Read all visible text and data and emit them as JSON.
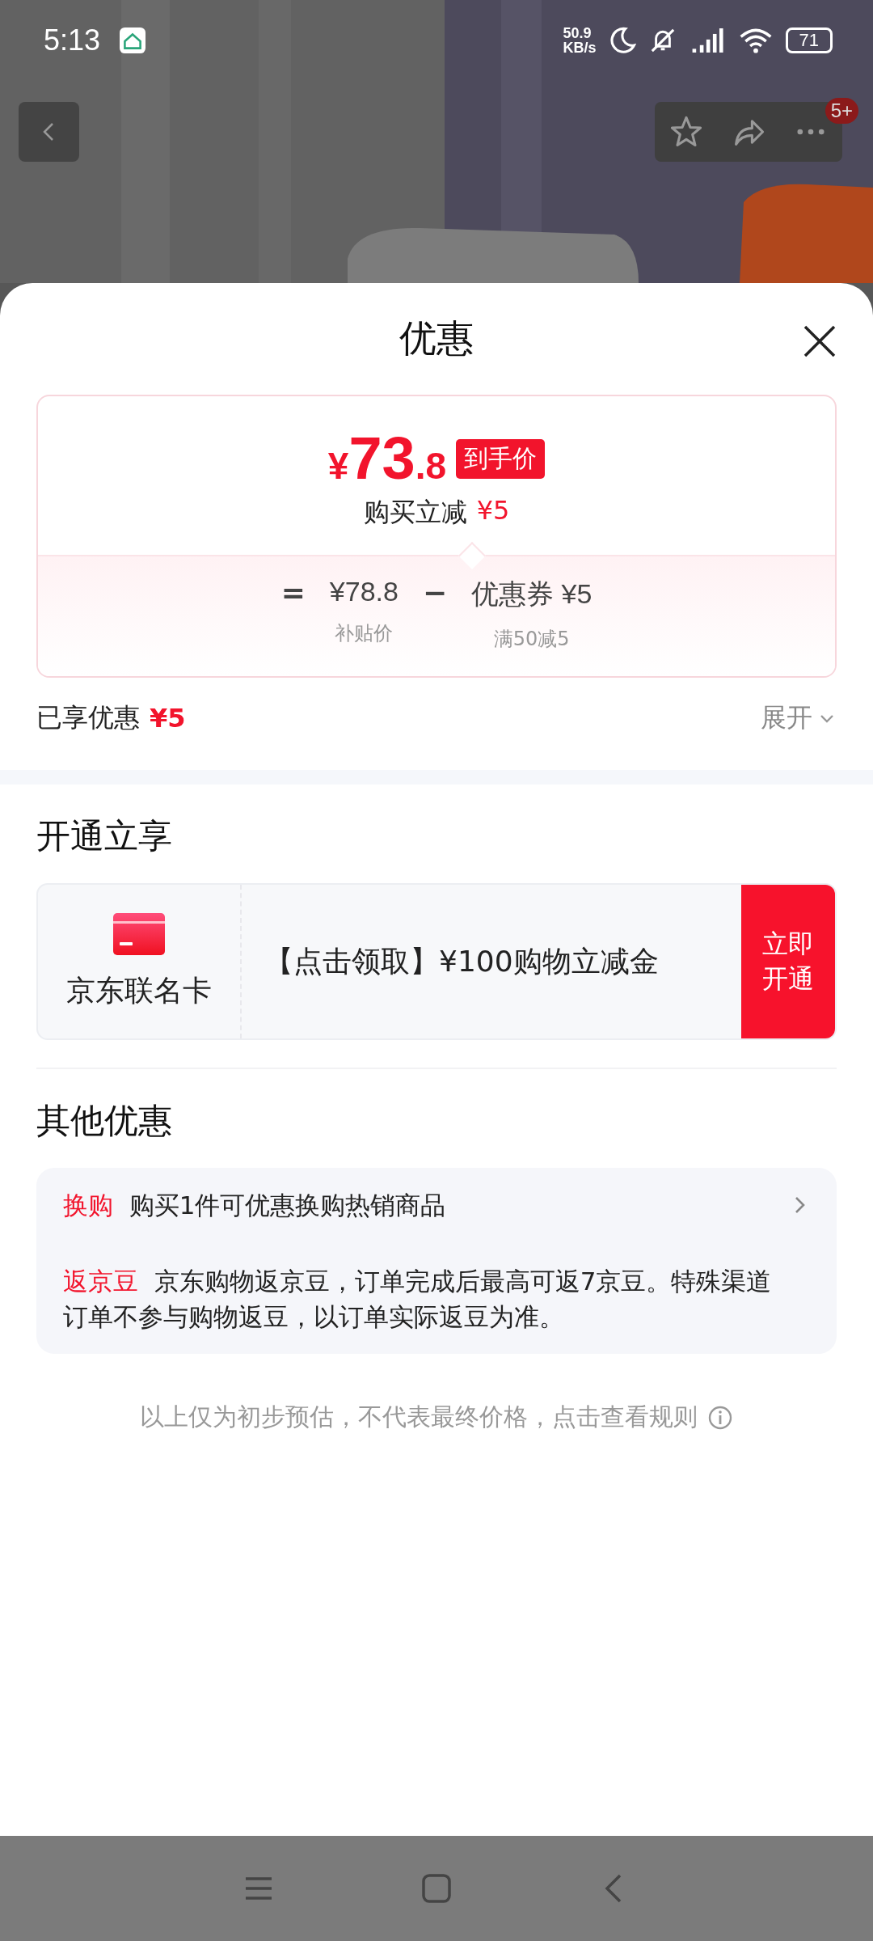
{
  "status_bar": {
    "time": "5:13",
    "net_speed_value": "50.9",
    "net_speed_unit": "KB/s",
    "battery": "71"
  },
  "product_header": {
    "kind": "picture",
    "message_badge": "5+"
  },
  "sheet": {
    "title": "优惠"
  },
  "price_summary": {
    "currency": "¥",
    "price_int": "73",
    "price_dec": ".8",
    "price_tag": "到手价",
    "discount_label": "购买立减",
    "discount_amount": "¥5",
    "breakdown": [
      {
        "kind": "operator",
        "text": "="
      },
      {
        "kind": "term",
        "value": "¥78.8",
        "caption": "补贴价"
      },
      {
        "kind": "operator",
        "text": "−"
      },
      {
        "kind": "term",
        "value": "优惠券 ¥5",
        "caption": "满50减5"
      }
    ]
  },
  "enjoyed": {
    "label": "已享优惠",
    "amount": "¥5",
    "toggle": "展开",
    "expanded": false
  },
  "open_section": {
    "title": "开通立享",
    "card_name": "京东联名卡",
    "offer": "【点击领取】¥100购物立减金",
    "button": "立即开通"
  },
  "other_section": {
    "title": "其他优惠",
    "items": [
      {
        "tag": "换购",
        "text": "购买1件可优惠换购热销商品",
        "has_arrow": true
      },
      {
        "tag": "返京豆",
        "text": "京东购物返京豆，订单完成后最高可返7京豆。特殊渠道订单不参与购物返豆，以订单实际返豆为准。",
        "has_arrow": false
      }
    ]
  },
  "footer_note": "以上仅为初步预估，不代表最终价格，点击查看规则"
}
